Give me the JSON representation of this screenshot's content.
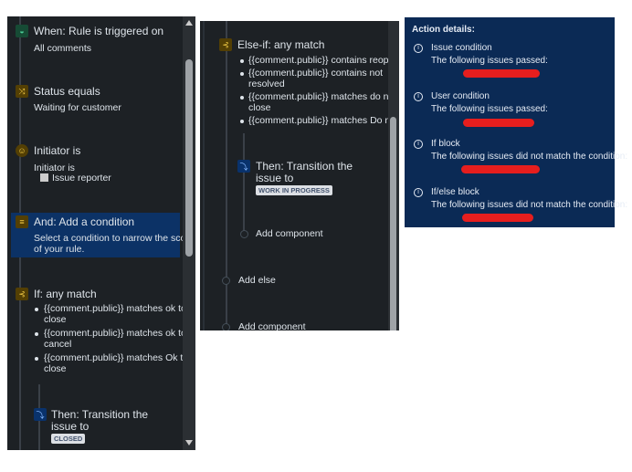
{
  "left_panel": {
    "trigger": {
      "title": "When: Rule is triggered on",
      "detail": "All comments"
    },
    "status": {
      "title": "Status equals",
      "detail": "Waiting for customer"
    },
    "initiator": {
      "title": "Initiator is",
      "detail": "Initiator is",
      "value": "Issue reporter"
    },
    "and": {
      "title": "And: Add a condition",
      "detail1": "Select a condition to narrow the scope",
      "detail2": "of your rule."
    },
    "if": {
      "title": "If: any match",
      "items": [
        [
          "{{comment.public}} matches ok to",
          "close"
        ],
        [
          "{{comment.public}} matches ok to",
          "cancel"
        ],
        [
          "{{comment.public}} matches Ok to",
          "close"
        ]
      ]
    },
    "then": {
      "title1": "Then: Transition the",
      "title2": "issue to",
      "status": "CLOSED"
    }
  },
  "middle_panel": {
    "elseif": {
      "title": "Else-if: any match",
      "items": [
        [
          "{{comment.public}} contains reopen",
          ""
        ],
        [
          "{{comment.public}} contains not",
          "resolved"
        ],
        [
          "{{comment.public}} matches do not",
          "close"
        ],
        [
          "{{comment.public}} matches Do not",
          ""
        ]
      ]
    },
    "then": {
      "title1": "Then: Transition the",
      "title2": "issue to",
      "status": "WORK IN PROGRESS"
    },
    "add_component_inner": "Add component",
    "add_else": "Add else",
    "add_component": "Add component"
  },
  "right_panel": {
    "title": "Action details:",
    "entries": [
      {
        "label": "Issue condition",
        "text": "The following issues passed:"
      },
      {
        "label": "User condition",
        "text": "The following issues passed:"
      },
      {
        "label": "If block",
        "text": "The following issues did not match the condition:"
      },
      {
        "label": "If/else block",
        "text": "The following issues did not match the condition:"
      }
    ]
  }
}
